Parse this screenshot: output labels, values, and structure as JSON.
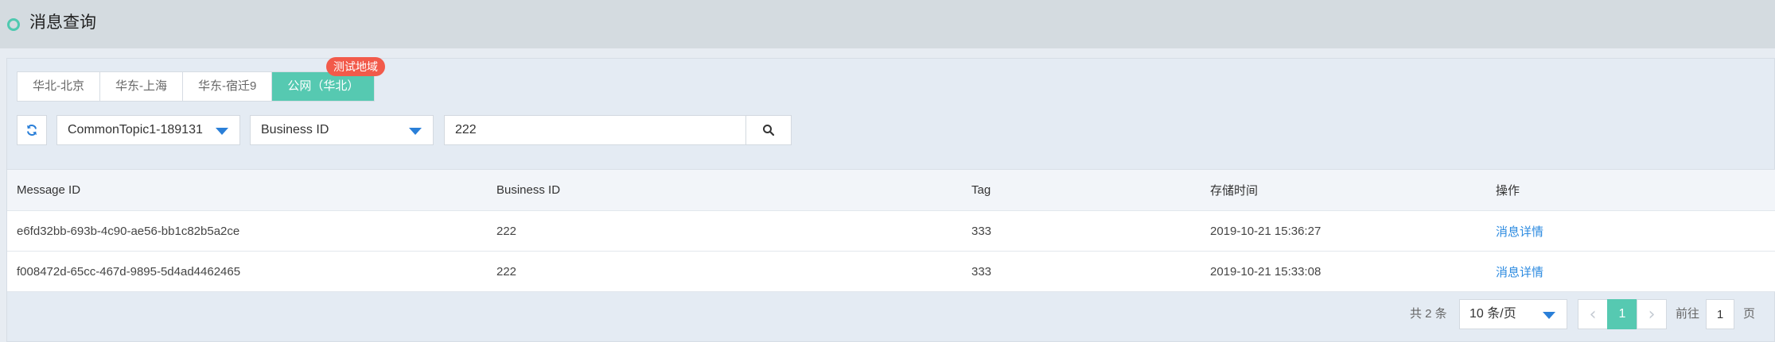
{
  "header": {
    "title": "消息查询"
  },
  "region_tabs": [
    {
      "label": "华北-北京"
    },
    {
      "label": "华东-上海"
    },
    {
      "label": "华东-宿迁9"
    },
    {
      "label": "公网（华北）"
    }
  ],
  "active_tab_index": 3,
  "tab_badge": "测试地域",
  "filters": {
    "topic_select": "CommonTopic1-189131",
    "search_type_select": "Business ID",
    "search_value": "222"
  },
  "table": {
    "columns": [
      "Message ID",
      "Business ID",
      "Tag",
      "存储时间",
      "操作"
    ],
    "rows": [
      {
        "message_id": "e6fd32bb-693b-4c90-ae56-bb1c82b5a2ce",
        "business_id": "222",
        "tag": "333",
        "time": "2019-10-21 15:36:27",
        "action": "消息详情"
      },
      {
        "message_id": "f008472d-65cc-467d-9895-5d4ad4462465",
        "business_id": "222",
        "tag": "333",
        "time": "2019-10-21 15:33:08",
        "action": "消息详情"
      }
    ]
  },
  "pagination": {
    "total_text": "共 2 条",
    "page_size": "10 条/页",
    "current_page": "1",
    "goto_label": "前往",
    "goto_value": "1",
    "page_suffix": "页"
  },
  "icons": {
    "title": "ring-icon",
    "refresh": "refresh-icon",
    "search": "search-icon",
    "caret": "caret-down-icon",
    "prev": "chevron-left-icon",
    "next": "chevron-right-icon"
  },
  "colors": {
    "accent": "#56c9b1",
    "badge": "#f25a4a",
    "link": "#2d8be0"
  }
}
